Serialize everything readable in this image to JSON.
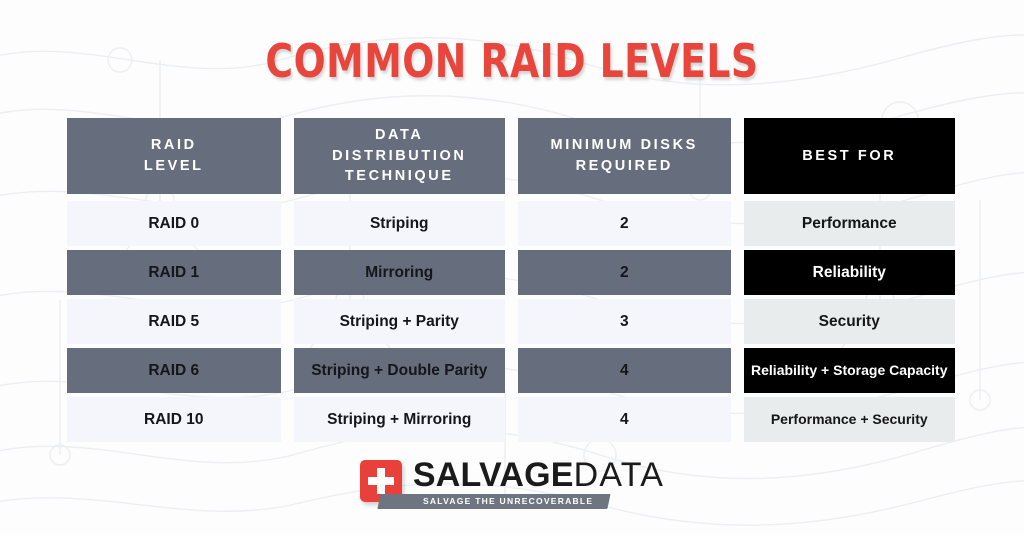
{
  "title": "COMMON RAID LEVELS",
  "accent_color": "#e8463c",
  "header_bg": "#666e7d",
  "header_bg_alt": "#000000",
  "row_light": "#f4f6fb",
  "row_shade": "#666e7d",
  "col4_light": "#e8ecec",
  "col4_dark": "#000000",
  "table": {
    "columns": [
      {
        "label": "RAID\nLEVEL",
        "line1": "RAID",
        "line2": "LEVEL",
        "style": "gray"
      },
      {
        "label": "DATA DISTRIBUTION TECHNIQUE",
        "line1": "DATA",
        "line2": "DISTRIBUTION",
        "line3": "TECHNIQUE",
        "style": "gray"
      },
      {
        "label": "MINIMUM DISKS REQUIRED",
        "line1": "MINIMUM DISKS",
        "line2": "REQUIRED",
        "style": "gray"
      },
      {
        "label": "BEST FOR",
        "line1": "BEST FOR",
        "style": "black"
      }
    ],
    "rows": [
      {
        "raid_level": "RAID 0",
        "distribution": "Striping",
        "min_disks": "2",
        "best_for": "Performance",
        "shade": "light"
      },
      {
        "raid_level": "RAID 1",
        "distribution": "Mirroring",
        "min_disks": "2",
        "best_for": "Reliability",
        "shade": "shade"
      },
      {
        "raid_level": "RAID 5",
        "distribution": "Striping + Parity",
        "min_disks": "3",
        "best_for": "Security",
        "shade": "light"
      },
      {
        "raid_level": "RAID 6",
        "distribution": "Striping + Double Parity",
        "min_disks": "4",
        "best_for": "Reliability + Storage Capacity",
        "shade": "shade"
      },
      {
        "raid_level": "RAID 10",
        "distribution": "Striping + Mirroring",
        "min_disks": "4",
        "best_for": "Performance + Security",
        "shade": "light"
      }
    ]
  },
  "logo": {
    "mark_icon": "red-plus-icon",
    "word_bold": "SALVAGE",
    "word_light": "DATA",
    "tagline": "SALVAGE THE UNRECOVERABLE"
  }
}
